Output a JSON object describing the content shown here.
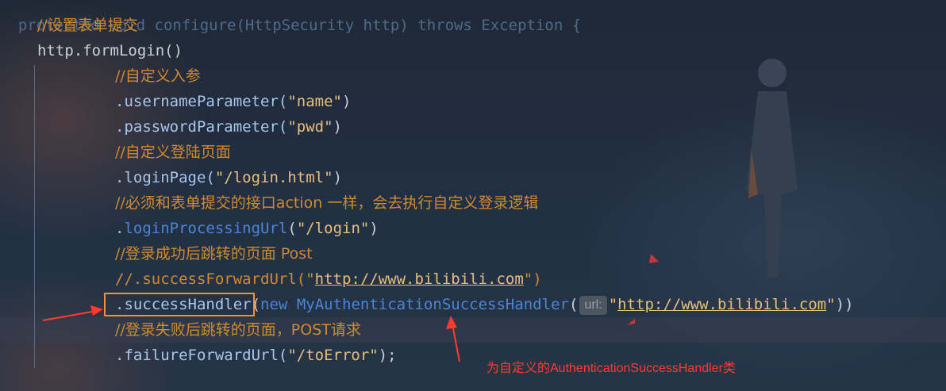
{
  "code": {
    "line0": {
      "keyword1": "protected",
      "keyword2": "void",
      "method": "configure",
      "params": "(HttpSecurity http)",
      "keyword3": "throws",
      "exception": "Exception {"
    },
    "line1": "//设置表单提交",
    "line2": "http.formLogin()",
    "line3": "//自定义入参",
    "line4": {
      "method": ".usernameParameter(",
      "arg": "\"name\"",
      "close": ")"
    },
    "line5": {
      "method": ".passwordParameter(",
      "arg": "\"pwd\"",
      "close": ")"
    },
    "line6": "//自定义登陆页面",
    "line7": {
      "method": ".loginPage(",
      "arg": "\"/login.html\"",
      "close": ")"
    },
    "line8": "//必须和表单提交的接口action 一样，会去执行自定义登录逻辑",
    "line9": {
      "dot": ".",
      "method": "loginProcessingUrl",
      "open": "(",
      "arg": "\"/login\"",
      "close": ")"
    },
    "line10": "//登录成功后跳转的页面 Post",
    "line11": {
      "prefix": "//.successForwardUrl(\"",
      "url": "http://www.bilibili.com",
      "suffix": "\")"
    },
    "line12": {
      "method": ".successHandler",
      "open": "(",
      "kw_new": "new",
      "cls": "MyAuthenticationSuccessHandler",
      "paren": "(",
      "hint": "url:",
      "q1": "\"",
      "url": "http://www.bilibili.com",
      "q2": "\"",
      "close": "))"
    },
    "line13": "//登录失败后跳转的页面，POST请求",
    "line14": {
      "method": ".failureForwardUrl(",
      "arg": "\"/toError\"",
      "close": ");"
    }
  },
  "annotation": {
    "text": "为自定义的AuthenticationSuccessHandler类",
    "color": "#ff3b30",
    "box_color": "#f0923a"
  }
}
